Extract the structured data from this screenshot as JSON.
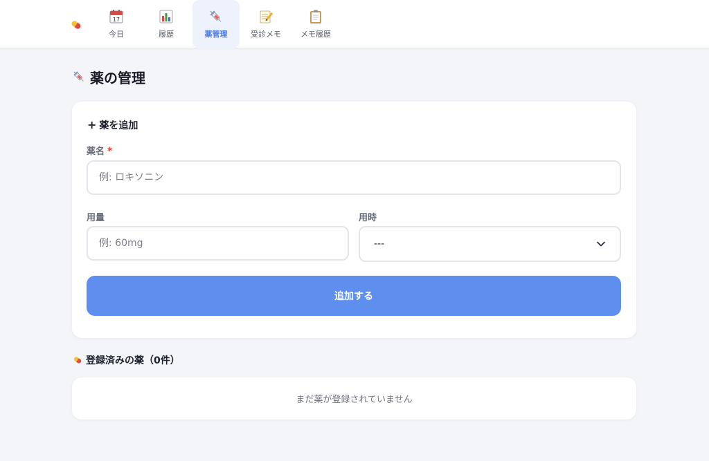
{
  "nav": {
    "tabs": [
      {
        "label": "今日",
        "icon": "calendar-icon",
        "active": false
      },
      {
        "label": "履歴",
        "icon": "bar-chart-icon",
        "active": false
      },
      {
        "label": "薬管理",
        "icon": "syringe-icon",
        "active": true
      },
      {
        "label": "受診メモ",
        "icon": "memo-icon",
        "active": false
      },
      {
        "label": "メモ履歴",
        "icon": "clipboard-icon",
        "active": false
      }
    ]
  },
  "page": {
    "title": "薬の管理"
  },
  "add_form": {
    "heading": "薬を追加",
    "plus_glyph": "+",
    "name_label": "薬名",
    "required_mark": "*",
    "name_placeholder": "例: ロキソニン",
    "dose_label": "用量",
    "dose_placeholder": "例: 60mg",
    "timing_label": "用時",
    "timing_selected": "---",
    "submit_label": "追加する"
  },
  "registered": {
    "heading": "登録済みの薬（0件）",
    "empty_message": "まだ薬が登録されていません"
  },
  "colors": {
    "accent": "#5f8fee",
    "active_tab_bg": "#edf2fc",
    "required": "#e04545",
    "background": "#f3f5f9"
  }
}
